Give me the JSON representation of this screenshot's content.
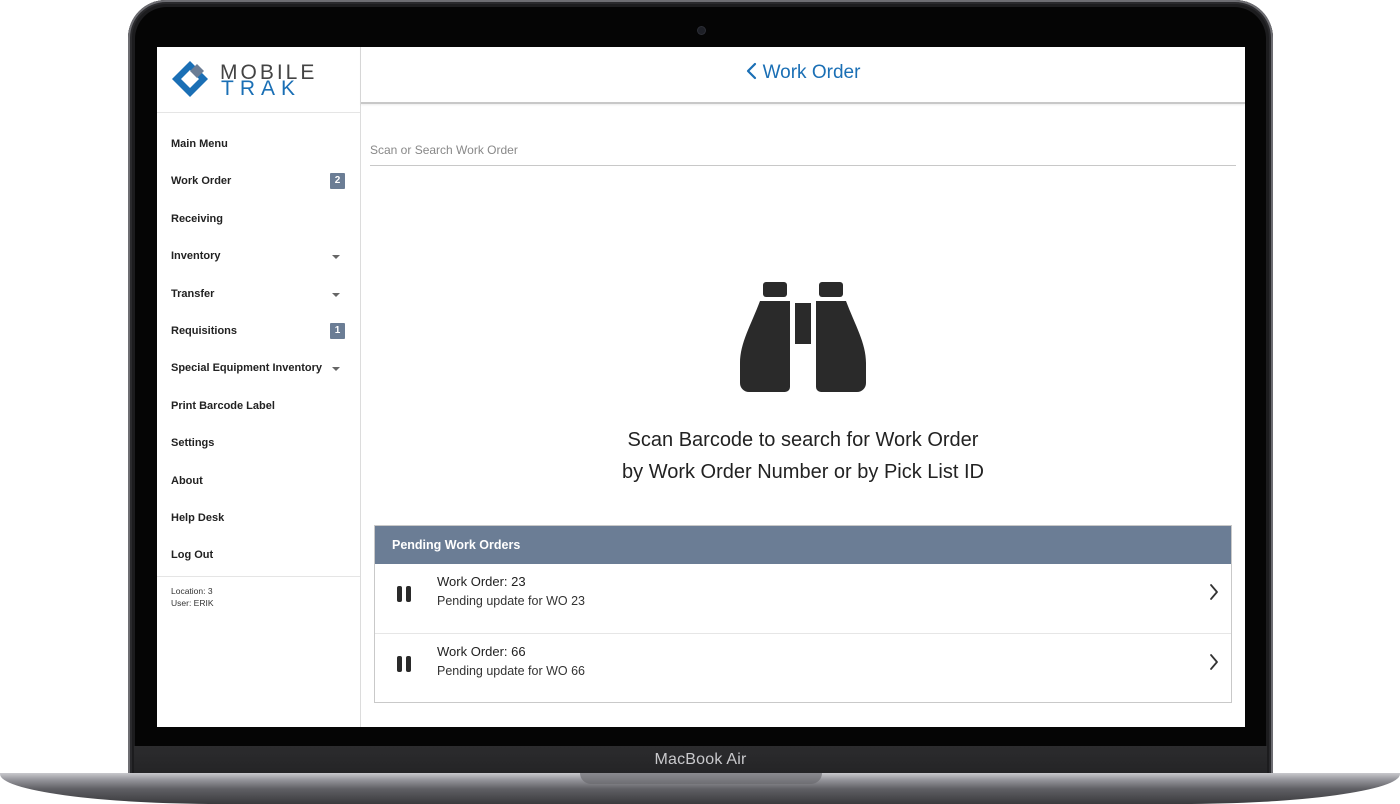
{
  "device": {
    "model": "MacBook Air"
  },
  "logo": {
    "line1": "MOBILE",
    "line2": "TRAK"
  },
  "sidebar": {
    "items": [
      {
        "label": "Main Menu"
      },
      {
        "label": "Work Order",
        "badge": "2"
      },
      {
        "label": "Receiving"
      },
      {
        "label": "Inventory",
        "expandable": true
      },
      {
        "label": "Transfer",
        "expandable": true
      },
      {
        "label": "Requisitions",
        "badge": "1"
      },
      {
        "label": "Special Equipment Inventory",
        "expandable": true
      },
      {
        "label": "Print Barcode Label"
      },
      {
        "label": "Settings"
      },
      {
        "label": "About"
      },
      {
        "label": "Help Desk"
      },
      {
        "label": "Log Out"
      }
    ],
    "footer": {
      "location": "Location: 3",
      "user": "User: ERIK"
    }
  },
  "header": {
    "title": "Work Order",
    "back_icon": "chevron-left-icon"
  },
  "search": {
    "placeholder": "Scan or Search Work Order",
    "value": ""
  },
  "empty_state": {
    "icon": "binoculars-icon",
    "line1": "Scan Barcode to search for Work Order",
    "line2": "by Work Order Number or by Pick List ID"
  },
  "pending": {
    "title": "Pending Work Orders",
    "rows": [
      {
        "title": "Work Order: 23",
        "subtitle": "Pending update for WO 23",
        "icon": "pause-icon"
      },
      {
        "title": "Work Order: 66",
        "subtitle": "Pending update for WO 66",
        "icon": "pause-icon"
      }
    ]
  },
  "colors": {
    "accent": "#1a6fb5",
    "panel_header": "#6b7d95",
    "badge": "#6b7d95"
  }
}
